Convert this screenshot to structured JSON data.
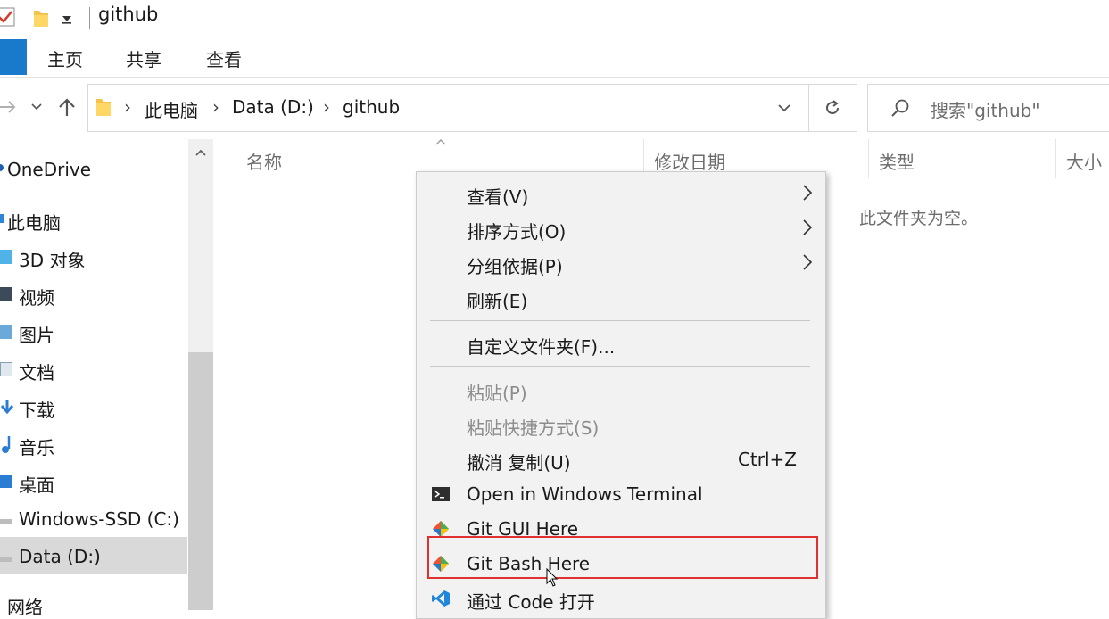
{
  "window": {
    "title": "github"
  },
  "ribbon": {
    "tabs": [
      "主页",
      "共享",
      "查看"
    ]
  },
  "address": {
    "crumbs": [
      "此电脑",
      "Data (D:)",
      "github"
    ],
    "search_placeholder": "搜索\"github\""
  },
  "nav": {
    "items": [
      {
        "label": "OneDrive",
        "icon": "cloud-icon"
      },
      {
        "label": "此电脑",
        "icon": "computer-icon"
      },
      {
        "label": "3D 对象",
        "icon": "3d-objects-icon"
      },
      {
        "label": "视频",
        "icon": "video-icon"
      },
      {
        "label": "图片",
        "icon": "pictures-icon"
      },
      {
        "label": "文档",
        "icon": "documents-icon"
      },
      {
        "label": "下载",
        "icon": "download-icon"
      },
      {
        "label": "音乐",
        "icon": "music-icon"
      },
      {
        "label": "桌面",
        "icon": "desktop-icon"
      },
      {
        "label": "Windows-SSD (C:)",
        "icon": "drive-icon"
      },
      {
        "label": "Data (D:)",
        "icon": "drive-icon",
        "selected": true
      },
      {
        "label": "网络",
        "icon": "network-icon"
      }
    ]
  },
  "columns": [
    "名称",
    "修改日期",
    "类型",
    "大小"
  ],
  "empty_message": "此文件夹为空。",
  "context_menu": {
    "items": [
      {
        "label": "查看(V)",
        "submenu": true
      },
      {
        "label": "排序方式(O)",
        "submenu": true
      },
      {
        "label": "分组依据(P)",
        "submenu": true
      },
      {
        "label": "刷新(E)"
      },
      {
        "separator": true
      },
      {
        "label": "自定义文件夹(F)..."
      },
      {
        "separator": true
      },
      {
        "label": "粘贴(P)",
        "disabled": true
      },
      {
        "label": "粘贴快捷方式(S)",
        "disabled": true
      },
      {
        "label": "撤消 复制(U)",
        "shortcut": "Ctrl+Z"
      },
      {
        "label": "Open in Windows Terminal",
        "icon": "terminal-icon"
      },
      {
        "label": "Git GUI Here",
        "icon": "git-icon"
      },
      {
        "label": "Git Bash Here",
        "icon": "git-icon",
        "highlighted": true
      },
      {
        "label": "通过 Code 打开",
        "icon": "vscode-icon"
      }
    ]
  },
  "colors": {
    "accent": "#1979ca",
    "highlight_border": "#e03131"
  }
}
